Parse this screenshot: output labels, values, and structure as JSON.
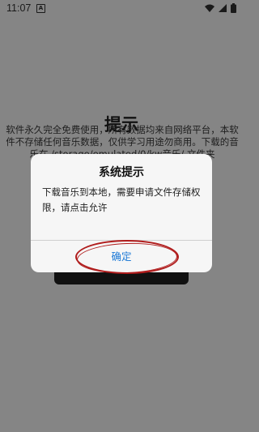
{
  "status_bar": {
    "time": "11:07",
    "notification_icon": "A",
    "icons": [
      "wifi-icon",
      "signal-icon",
      "battery-icon"
    ]
  },
  "background": {
    "title": "提示",
    "description": "软件永久完全免费使用，所有数据均来自网络平台，本软件不存储任何音乐数据，仅供学习用途勿商用。下载的音乐在 /storage/emulated/0/kw音乐/ 文件夹"
  },
  "dialog": {
    "title": "系统提示",
    "message": "下载音乐到本地，需要申请文件存储权限，请点击允许",
    "confirm_label": "确定"
  },
  "colors": {
    "overlay": "#858585",
    "dialog_bg": "#f6f6f6",
    "confirm_text": "#1e7ad6",
    "annotation": "#b01c1c"
  }
}
